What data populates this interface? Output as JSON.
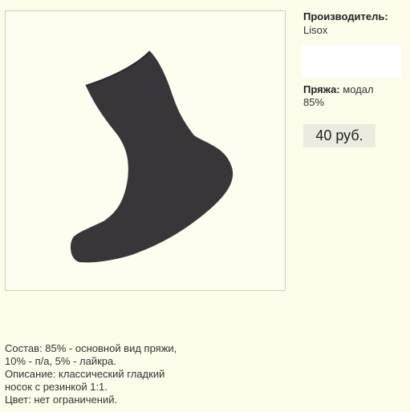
{
  "product": {
    "manufacturer_label": "Производитель:",
    "manufacturer_value": "Lisox",
    "yarn_label": "Пряжа:",
    "yarn_value_line1": "модал",
    "yarn_value_line2": "85%",
    "price": "40 руб.",
    "image_icon": "sock-image"
  },
  "description": {
    "lines": [
      "Состав: 85% - основной вид пряжи,",
      "10% - п/а, 5% - лайкра.",
      "Описание: классический гладкий",
      "носок с резинкой 1:1.",
      "Цвет: нет ограничений."
    ]
  },
  "colors": {
    "background": "#fdfbea",
    "sock": "#3a3538",
    "price_bg": "#ebebe0"
  }
}
